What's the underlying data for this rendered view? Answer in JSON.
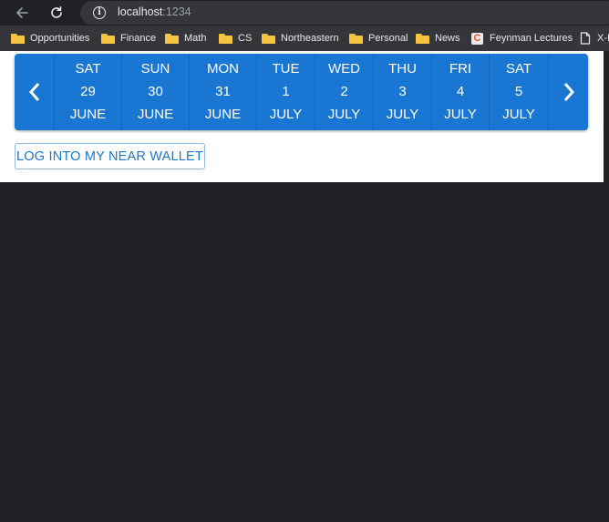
{
  "browser": {
    "url_host": "localhost",
    "url_port": ":1234"
  },
  "bookmarks": [
    {
      "label": "Opportunities",
      "icon": "folder-icon"
    },
    {
      "label": "Finance",
      "icon": "folder-icon"
    },
    {
      "label": "Math",
      "icon": "folder-icon"
    },
    {
      "label": "CS",
      "icon": "folder-icon"
    },
    {
      "label": "Northeastern",
      "icon": "folder-icon"
    },
    {
      "label": "Personal",
      "icon": "folder-icon"
    },
    {
      "label": "News",
      "icon": "folder-icon"
    },
    {
      "label": "Feynman Lectures",
      "icon": "feynman-favicon-icon"
    },
    {
      "label": "X-I",
      "icon": "document-icon"
    }
  ],
  "date_picker": {
    "days": [
      {
        "dow": "SAT",
        "date": "29",
        "month": "JUNE"
      },
      {
        "dow": "SUN",
        "date": "30",
        "month": "JUNE"
      },
      {
        "dow": "MON",
        "date": "31",
        "month": "JUNE"
      },
      {
        "dow": "TUE",
        "date": "1",
        "month": "JULY"
      },
      {
        "dow": "WED",
        "date": "2",
        "month": "JULY"
      },
      {
        "dow": "THU",
        "date": "3",
        "month": "JULY"
      },
      {
        "dow": "FRI",
        "date": "4",
        "month": "JULY"
      },
      {
        "dow": "SAT",
        "date": "5",
        "month": "JULY"
      }
    ]
  },
  "login": {
    "label": "LOG INTO MY NEAR WALLET"
  },
  "colors": {
    "primary": "#1976d2",
    "browser_dark": "#202124",
    "bookmark_bar": "#35363a"
  }
}
